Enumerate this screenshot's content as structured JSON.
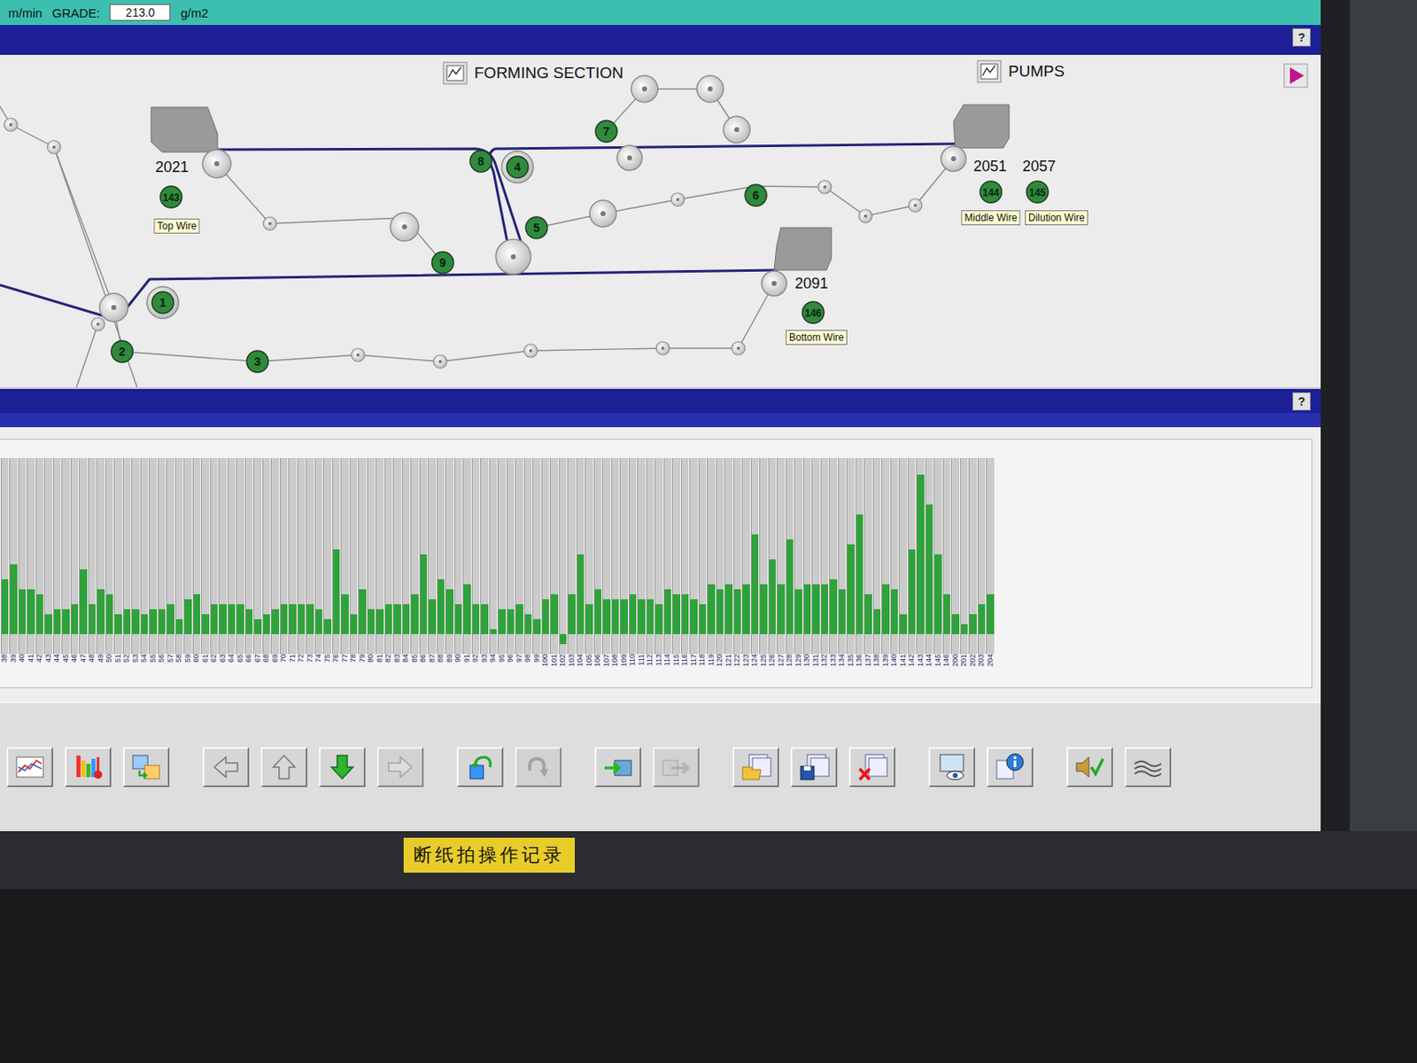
{
  "header": {
    "speed_unit": "m/min",
    "grade_label": "GRADE:",
    "grade_value": "213.0",
    "grade_unit": "g/m2"
  },
  "top_help": "?",
  "diagram": {
    "title": "FORMING SECTION",
    "pumps": "PUMPS",
    "rolls": [
      {
        "label": "1"
      },
      {
        "label": "2"
      },
      {
        "label": "3"
      },
      {
        "label": "4"
      },
      {
        "label": "5"
      },
      {
        "label": "6"
      },
      {
        "label": "7"
      },
      {
        "label": "8"
      },
      {
        "label": "9"
      }
    ],
    "wires": [
      {
        "number": "2021",
        "id": "143",
        "label": "Top Wire"
      },
      {
        "number": "2051",
        "id": "144",
        "label": "Middle Wire"
      },
      {
        "number": "2057",
        "id": "145",
        "label": "Dilution Wire"
      },
      {
        "number": "2091",
        "id": "146",
        "label": "Bottom Wire"
      }
    ]
  },
  "chart_help": "?",
  "chart": {
    "labels": [
      "38",
      "39",
      "40",
      "41",
      "42",
      "43",
      "44",
      "45",
      "46",
      "47",
      "48",
      "49",
      "50",
      "51",
      "52",
      "53",
      "54",
      "55",
      "56",
      "57",
      "58",
      "59",
      "60",
      "61",
      "62",
      "63",
      "64",
      "65",
      "66",
      "67",
      "68",
      "69",
      "70",
      "71",
      "72",
      "73",
      "74",
      "75",
      "76",
      "77",
      "78",
      "79",
      "80",
      "81",
      "82",
      "83",
      "84",
      "85",
      "86",
      "87",
      "88",
      "89",
      "90",
      "91",
      "92",
      "93",
      "94",
      "95",
      "96",
      "97",
      "98",
      "99",
      "100",
      "101",
      "102",
      "103",
      "104",
      "105",
      "106",
      "107",
      "108",
      "109",
      "110",
      "111",
      "112",
      "113",
      "114",
      "115",
      "116",
      "117",
      "118",
      "119",
      "120",
      "121",
      "122",
      "123",
      "124",
      "125",
      "126",
      "127",
      "128",
      "129",
      "130",
      "131",
      "132",
      "133",
      "134",
      "135",
      "136",
      "137",
      "138",
      "139",
      "140",
      "141",
      "142",
      "143",
      "144",
      "145",
      "146",
      "200",
      "201",
      "202",
      "203",
      "204"
    ],
    "values": [
      5.5,
      7,
      4.5,
      4.5,
      4,
      2,
      2.5,
      2.5,
      3,
      6.5,
      3,
      4.5,
      4,
      2,
      2.5,
      2.5,
      2,
      2.5,
      2.5,
      3,
      1.5,
      3.5,
      4,
      2,
      3,
      3,
      3,
      3,
      2.5,
      1.5,
      2,
      2.5,
      3,
      3,
      3,
      3,
      2.5,
      1.5,
      8.5,
      4,
      2,
      4.5,
      2.5,
      2.5,
      3,
      3,
      3,
      4,
      8,
      3.5,
      5.5,
      4.5,
      3,
      5,
      3,
      3,
      0.5,
      2.5,
      2.5,
      3,
      2,
      1.5,
      3.5,
      4,
      -1,
      4,
      8,
      3,
      4.5,
      3.5,
      3.5,
      3.5,
      4,
      3.5,
      3.5,
      3,
      4.5,
      4,
      4,
      3.5,
      3,
      5,
      4.5,
      5,
      4.5,
      5,
      10,
      5,
      7.5,
      5,
      9.5,
      4.5,
      5,
      5,
      5,
      5.5,
      4.5,
      9,
      12,
      4,
      2.5,
      5,
      4.5,
      2,
      8.5,
      16,
      13,
      8,
      4,
      2,
      1,
      2,
      3,
      4
    ]
  },
  "toolbar": [
    {
      "disabled": false
    },
    {
      "disabled": false
    },
    {
      "disabled": false
    },
    {
      "disabled": false
    },
    {
      "disabled": false
    },
    {
      "disabled": false
    },
    {
      "disabled": true
    },
    {
      "disabled": false
    },
    {
      "disabled": true
    },
    {
      "disabled": false
    },
    {
      "disabled": true
    },
    {
      "disabled": false
    },
    {
      "disabled": false
    },
    {
      "disabled": false
    },
    {
      "disabled": false
    },
    {
      "disabled": false
    },
    {
      "disabled": false
    },
    {
      "disabled": false
    }
  ],
  "sticker": "断纸拍操作记录"
}
